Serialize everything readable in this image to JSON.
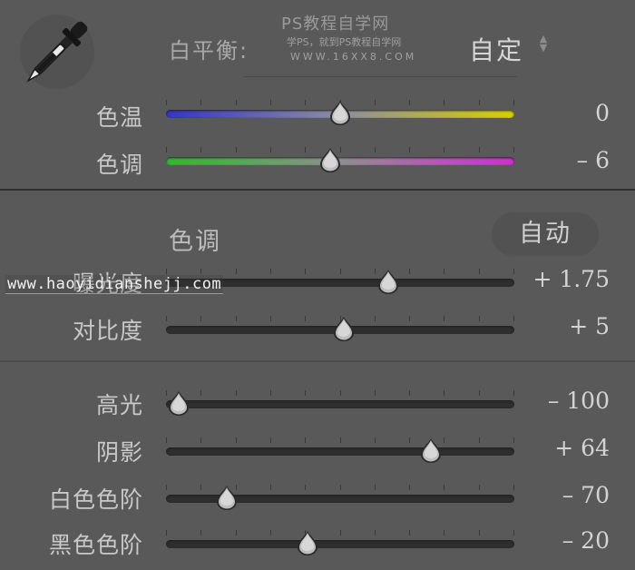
{
  "white_balance": {
    "label": "白平衡:",
    "value": "自定",
    "stepper_up": "▲",
    "stepper_down": "▼",
    "eyedropper_icon": "eyedropper-icon",
    "sliders": [
      {
        "label": "色温",
        "value": "0",
        "position": 0.5
      },
      {
        "label": "色调",
        "value": "– 6",
        "position": 0.47
      }
    ]
  },
  "watermark": {
    "line1": "PS教程自学网",
    "line2": "学PS，就到PS教程自学网",
    "line3": "WWW.16XX8.COM"
  },
  "tone": {
    "title": "色调",
    "auto_label": "自动",
    "site_watermark": "www.haoyidianshejj.com",
    "group1": [
      {
        "label": "曝光度",
        "value": "+ 1.75",
        "position": 0.65
      },
      {
        "label": "对比度",
        "value": "+ 5",
        "position": 0.51
      }
    ],
    "group2": [
      {
        "label": "高光",
        "value": "– 100",
        "position": 0.0
      },
      {
        "label": "阴影",
        "value": "+ 64",
        "position": 0.78
      },
      {
        "label": "白色色阶",
        "value": "– 70",
        "position": 0.15
      },
      {
        "label": "黑色色阶",
        "value": "– 20",
        "position": 0.4
      }
    ]
  },
  "colors": {
    "temp_gradient": [
      "#3a3ad0",
      "#9a9a9a",
      "#e0d000"
    ],
    "tint_gradient": [
      "#30c030",
      "#9a9a9a",
      "#d030d0"
    ]
  }
}
